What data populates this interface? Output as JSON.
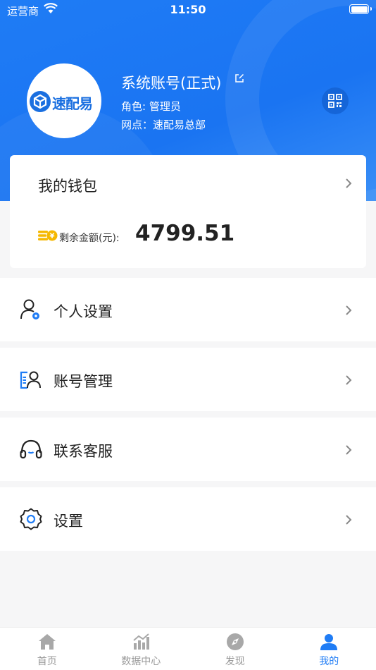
{
  "status_bar": {
    "carrier": "运营商",
    "time": "11:50"
  },
  "profile": {
    "logo_text": "速配易",
    "account_name": "系统账号(正式)",
    "role": "角色: 管理员",
    "outlet": "网点：速配易总部"
  },
  "wallet": {
    "title": "我的钱包",
    "balance_label": "剩余金额(元):",
    "balance_value": "4799.51"
  },
  "menu": [
    {
      "label": "个人设置",
      "icon": "user-settings-icon"
    },
    {
      "label": "账号管理",
      "icon": "account-manage-icon"
    },
    {
      "label": "联系客服",
      "icon": "headset-icon"
    },
    {
      "label": "设置",
      "icon": "gear-icon"
    }
  ],
  "tabs": [
    {
      "label": "首页",
      "icon": "home-icon"
    },
    {
      "label": "数据中心",
      "icon": "chart-icon"
    },
    {
      "label": "发现",
      "icon": "compass-icon"
    },
    {
      "label": "我的",
      "icon": "person-icon",
      "active": true
    }
  ],
  "colors": {
    "brand": "#1f7cf5",
    "inactive": "#9a9a9a",
    "coin": "#f5b800"
  }
}
